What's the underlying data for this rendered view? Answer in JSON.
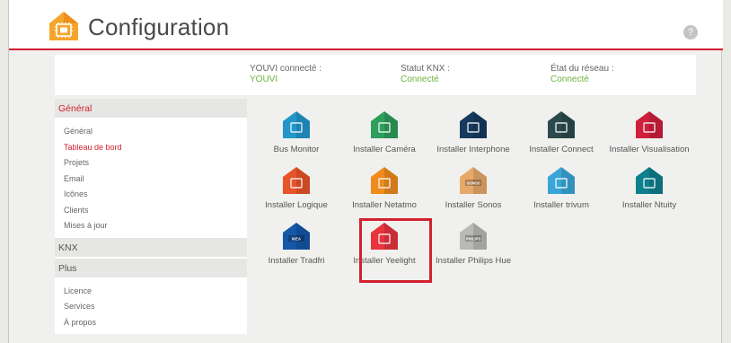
{
  "app": {
    "title": "Configuration",
    "help_label": "?"
  },
  "status": {
    "youvi_label": "YOUVI connecté :",
    "youvi_value": "YOUVI",
    "knx_label": "Statut KNX :",
    "knx_value": "Connecté",
    "network_label": "État du réseau :",
    "network_value": "Connecté"
  },
  "sidebar": {
    "general_head": "Général",
    "general_items": [
      "Général",
      "Tableau de bord",
      "Projets",
      "Email",
      "Icônes",
      "Clients",
      "Mises à jour"
    ],
    "knx_head": "KNX",
    "plus_head": "Plus",
    "plus_items": [
      "Licence",
      "Services",
      "À propos"
    ]
  },
  "tiles": [
    {
      "label": "Bus Monitor",
      "icon": "bus-monitor-icon",
      "color": "#2196c9",
      "badge": ""
    },
    {
      "label": "Installer Caméra",
      "icon": "camera-icon",
      "color": "#2e9e5b",
      "badge": ""
    },
    {
      "label": "Installer Interphone",
      "icon": "intercom-icon",
      "color": "#163a5f",
      "badge": ""
    },
    {
      "label": "Installer Connect",
      "icon": "connect-icon",
      "color": "#2c4a4e",
      "badge": ""
    },
    {
      "label": "Installer Visualisation",
      "icon": "visualisation-icon",
      "color": "#cf1f3d",
      "badge": ""
    },
    {
      "label": "Installer Logique",
      "icon": "logic-icon",
      "color": "#e8532a",
      "badge": ""
    },
    {
      "label": "Installer Netatmo",
      "icon": "netatmo-icon",
      "color": "#f08b1e",
      "badge": ""
    },
    {
      "label": "Installer Sonos",
      "icon": "sonos-icon",
      "color": "#e7a96a",
      "badge": "SONOS"
    },
    {
      "label": "Installer trivum",
      "icon": "trivum-icon",
      "color": "#3aa6d8",
      "badge": ""
    },
    {
      "label": "Installer Ntuity",
      "icon": "ntuity-icon",
      "color": "#0e7f8c",
      "badge": ""
    },
    {
      "label": "Installer Tradfri",
      "icon": "tradfri-icon",
      "color": "#1557a8",
      "badge": "IKEA"
    },
    {
      "label": "Installer Yeelight",
      "icon": "yeelight-icon",
      "color": "#e8343e",
      "badge": ""
    },
    {
      "label": "Installer Philips Hue",
      "icon": "philips-hue-icon",
      "color": "#b9b9b7",
      "badge": "PHILIPS"
    }
  ],
  "colors": {
    "accent": "#d2202f",
    "connected": "#6db33f"
  }
}
